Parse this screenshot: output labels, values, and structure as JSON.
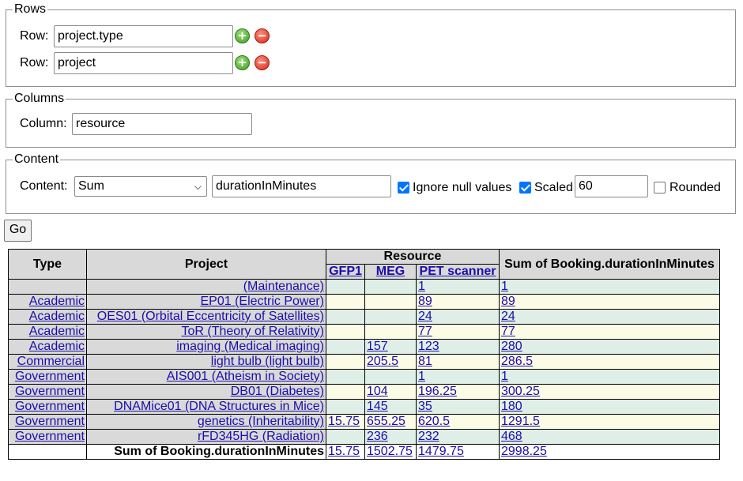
{
  "rows": {
    "legend": "Rows",
    "items": [
      {
        "label": "Row:",
        "value": "project.type"
      },
      {
        "label": "Row:",
        "value": "project"
      }
    ]
  },
  "columns": {
    "legend": "Columns",
    "label": "Column:",
    "value": "resource"
  },
  "content": {
    "legend": "Content",
    "label": "Content:",
    "aggregate": "Sum",
    "field": "durationInMinutes",
    "ignore_null_label": "Ignore null values",
    "ignore_null_checked": true,
    "scaled_label": "Scaled",
    "scaled_checked": true,
    "scale_value": "60",
    "rounded_label": "Rounded",
    "rounded_checked": false
  },
  "go_label": "Go",
  "pivot": {
    "headers": {
      "type": "Type",
      "project": "Project",
      "resource": "Resource",
      "sum": "Sum of Booking.durationInMinutes",
      "resources": [
        "GFP1",
        "MEG",
        "PET scanner"
      ]
    },
    "rows": [
      {
        "type": "",
        "project": "(Maintenance)",
        "gfp1": "",
        "meg": "",
        "pet": "1",
        "sum": "1"
      },
      {
        "type": "Academic",
        "project": "EP01 (Electric Power)",
        "gfp1": "",
        "meg": "",
        "pet": "89",
        "sum": "89"
      },
      {
        "type": "Academic",
        "project": "OES01 (Orbital Eccentricity of Satellites)",
        "gfp1": "",
        "meg": "",
        "pet": "24",
        "sum": "24"
      },
      {
        "type": "Academic",
        "project": "ToR (Theory of Relativity)",
        "gfp1": "",
        "meg": "",
        "pet": "77",
        "sum": "77"
      },
      {
        "type": "Academic",
        "project": "imaging (Medical imaging)",
        "gfp1": "",
        "meg": "157",
        "pet": "123",
        "sum": "280"
      },
      {
        "type": "Commercial",
        "project": "light bulb (light bulb)",
        "gfp1": "",
        "meg": "205.5",
        "pet": "81",
        "sum": "286.5"
      },
      {
        "type": "Government",
        "project": "AIS001 (Atheism in Society)",
        "gfp1": "",
        "meg": "",
        "pet": "1",
        "sum": "1"
      },
      {
        "type": "Government",
        "project": "DB01 (Diabetes)",
        "gfp1": "",
        "meg": "104",
        "pet": "196.25",
        "sum": "300.25"
      },
      {
        "type": "Government",
        "project": "DNAMice01 (DNA Structures in Mice)",
        "gfp1": "",
        "meg": "145",
        "pet": "35",
        "sum": "180"
      },
      {
        "type": "Government",
        "project": "genetics (Inheritability)",
        "gfp1": "15.75",
        "meg": "655.25",
        "pet": "620.5",
        "sum": "1291.5"
      },
      {
        "type": "Government",
        "project": "rFD345HG (Radiation)",
        "gfp1": "",
        "meg": "236",
        "pet": "232",
        "sum": "468"
      }
    ],
    "totals": {
      "label": "Sum of Booking.durationInMinutes",
      "gfp1": "15.75",
      "meg": "1502.75",
      "pet": "1479.75",
      "sum": "2998.25"
    }
  }
}
